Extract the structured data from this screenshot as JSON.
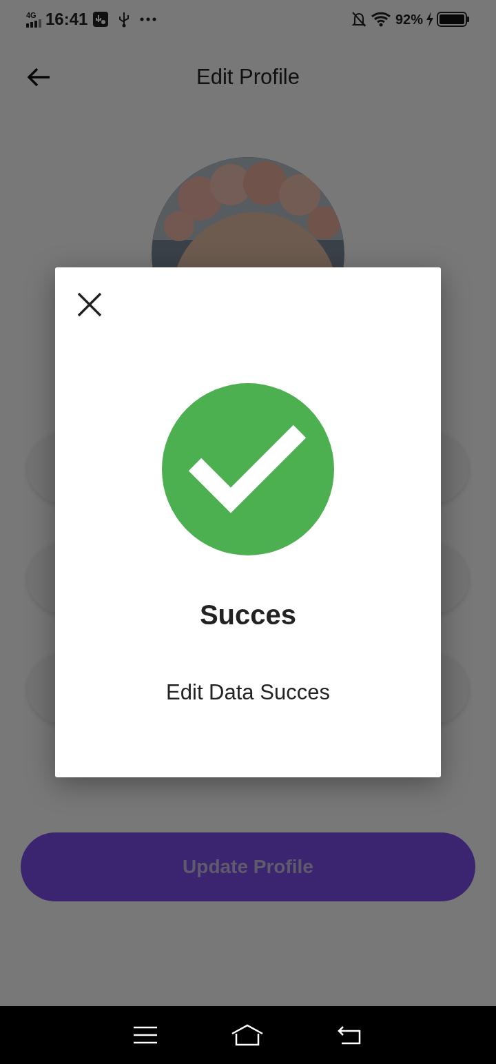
{
  "status_bar": {
    "network": "4G",
    "time": "16:41",
    "battery": "92%"
  },
  "header": {
    "title": "Edit Profile"
  },
  "fields": [
    {
      "kind": "text"
    },
    {
      "kind": "text"
    },
    {
      "kind": "text"
    }
  ],
  "update_button": {
    "label": "Update Profile"
  },
  "dialog": {
    "title": "Succes",
    "message": "Edit Data Succes"
  }
}
